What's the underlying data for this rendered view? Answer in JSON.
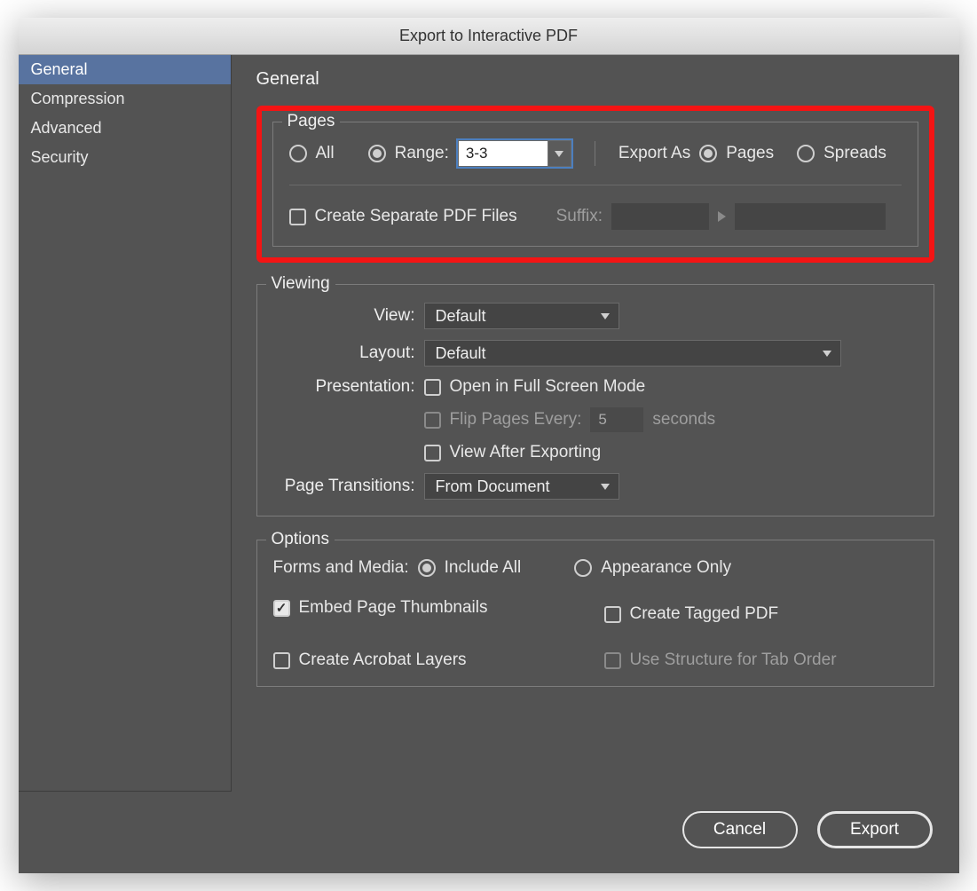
{
  "title": "Export to Interactive PDF",
  "sidebar": {
    "items": [
      {
        "label": "General",
        "active": true
      },
      {
        "label": "Compression",
        "active": false
      },
      {
        "label": "Advanced",
        "active": false
      },
      {
        "label": "Security",
        "active": false
      }
    ]
  },
  "main": {
    "heading": "General",
    "pages": {
      "legend": "Pages",
      "all_label": "All",
      "range_label": "Range:",
      "range_value": "3-3",
      "export_as_label": "Export As",
      "pages_label": "Pages",
      "spreads_label": "Spreads",
      "create_separate_label": "Create Separate PDF Files",
      "suffix_label": "Suffix:"
    },
    "viewing": {
      "legend": "Viewing",
      "view_label": "View:",
      "view_value": "Default",
      "layout_label": "Layout:",
      "layout_value": "Default",
      "presentation_label": "Presentation:",
      "fullscreen_label": "Open in Full Screen Mode",
      "flip_label": "Flip Pages Every:",
      "flip_value": "5",
      "seconds_label": "seconds",
      "view_after_label": "View After Exporting",
      "transitions_label": "Page Transitions:",
      "transitions_value": "From Document"
    },
    "options": {
      "legend": "Options",
      "forms_label": "Forms and Media:",
      "include_all_label": "Include All",
      "appearance_only_label": "Appearance Only",
      "embed_thumbs_label": "Embed Page Thumbnails",
      "tagged_pdf_label": "Create Tagged PDF",
      "acrobat_layers_label": "Create Acrobat Layers",
      "structure_tab_label": "Use Structure for Tab Order"
    }
  },
  "footer": {
    "cancel_label": "Cancel",
    "export_label": "Export"
  }
}
